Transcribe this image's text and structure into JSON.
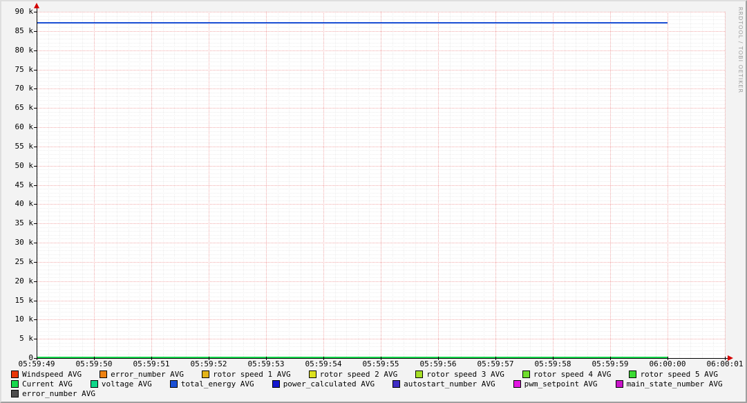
{
  "watermark": "RRDTOOL / TOBI OETIKER",
  "chart_data": {
    "type": "line",
    "title": "",
    "xlabel": "",
    "ylabel": "",
    "ylim": [
      0,
      90000
    ],
    "x_ticks": [
      "05:59:49",
      "05:59:50",
      "05:59:51",
      "05:59:52",
      "05:59:53",
      "05:59:54",
      "05:59:55",
      "05:59:56",
      "05:59:57",
      "05:59:58",
      "05:59:59",
      "06:00:00",
      "06:00:01"
    ],
    "y_ticks": [
      {
        "value": 0,
        "label": "0"
      },
      {
        "value": 5000,
        "label": "5 k"
      },
      {
        "value": 10000,
        "label": "10 k"
      },
      {
        "value": 15000,
        "label": "15 k"
      },
      {
        "value": 20000,
        "label": "20 k"
      },
      {
        "value": 25000,
        "label": "25 k"
      },
      {
        "value": 30000,
        "label": "30 k"
      },
      {
        "value": 35000,
        "label": "35 k"
      },
      {
        "value": 40000,
        "label": "40 k"
      },
      {
        "value": 45000,
        "label": "45 k"
      },
      {
        "value": 50000,
        "label": "50 k"
      },
      {
        "value": 55000,
        "label": "55 k"
      },
      {
        "value": 60000,
        "label": "60 k"
      },
      {
        "value": 65000,
        "label": "65 k"
      },
      {
        "value": 70000,
        "label": "70 k"
      },
      {
        "value": 75000,
        "label": "75 k"
      },
      {
        "value": 80000,
        "label": "80 k"
      },
      {
        "value": 85000,
        "label": "85 k"
      },
      {
        "value": 90000,
        "label": "90 k"
      }
    ],
    "grid": {
      "major_color": "#f2a9a9",
      "minor_color": "#ededed",
      "axis_color": "#000000",
      "arrow_color": "#d40000"
    },
    "series": [
      {
        "name": "total_energy AVG",
        "color": "#1b50d5",
        "value": 87100,
        "x_start": "05:59:49",
        "x_end": "06:00:00"
      },
      {
        "name": "Current AVG",
        "color": "#17d94d",
        "value": 0,
        "x_start": "05:59:49",
        "x_end": "06:00:00"
      }
    ],
    "legend_rows": [
      [
        {
          "label": "Windspeed AVG",
          "color": "#e93608"
        },
        {
          "label": "error_number AVG",
          "color": "#ee8212"
        },
        {
          "label": "rotor speed 1 AVG",
          "color": "#e3b419"
        },
        {
          "label": "rotor speed 2 AVG",
          "color": "#dce11f"
        },
        {
          "label": "rotor speed 3 AVG",
          "color": "#a6df26"
        },
        {
          "label": "rotor speed 4 AVG",
          "color": "#6fdd2c"
        },
        {
          "label": "rotor speed 5 AVG",
          "color": "#3bdb33"
        }
      ],
      [
        {
          "label": "Current AVG",
          "color": "#17d94d"
        },
        {
          "label": "voltage AVG",
          "color": "#0fd789"
        },
        {
          "label": "total_energy AVG",
          "color": "#1b50d5"
        },
        {
          "label": "power_calculated AVG",
          "color": "#1418cf"
        },
        {
          "label": "autostart_number AVG",
          "color": "#3e2dc6"
        },
        {
          "label": "pwm_setpoint AVG",
          "color": "#e316e3"
        },
        {
          "label": "main_state_number AVG",
          "color": "#c913c9"
        }
      ],
      [
        {
          "label": "error_number AVG",
          "color": "#4d4d4d"
        }
      ]
    ]
  }
}
